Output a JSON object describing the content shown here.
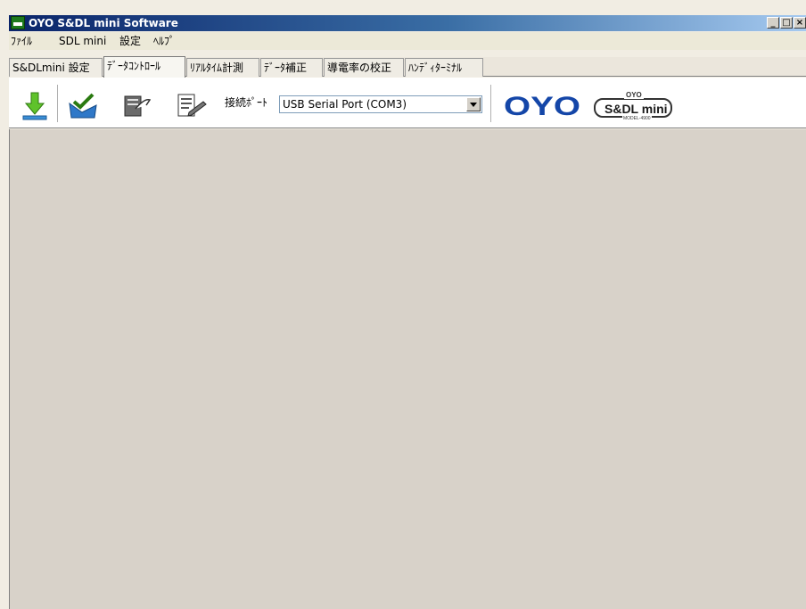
{
  "window": {
    "title": "OYO S&DL mini Software",
    "app_icon": "oyo-app-icon",
    "caption_buttons": {
      "minimize": "_",
      "maximize": "□",
      "close": "×"
    }
  },
  "menu": {
    "items": [
      {
        "label": "ﾌｧｲﾙ"
      },
      {
        "label": "SDL mini"
      },
      {
        "label": "設定"
      },
      {
        "label": "ﾍﾙﾌﾟ"
      }
    ]
  },
  "tabs": [
    {
      "label": "S&DLmini 設定",
      "active": false
    },
    {
      "label": "ﾃﾞｰﾀｺﾝﾄﾛｰﾙ",
      "active": true
    },
    {
      "label": "ﾘｱﾙﾀｲﾑ計測",
      "active": false
    },
    {
      "label": "ﾃﾞｰﾀ補正",
      "active": false
    },
    {
      "label": "導電率の校正",
      "active": false
    },
    {
      "label": "ﾊﾝﾃﾞｨﾀｰﾐﾅﾙ",
      "active": false
    }
  ],
  "toolbar": {
    "tools": [
      {
        "icon": "download-arrow-icon"
      },
      {
        "icon": "check-folder-icon"
      },
      {
        "icon": "document-transfer-icon"
      },
      {
        "icon": "edit-document-icon"
      }
    ],
    "port_label": "接続ﾎﾟｰﾄ",
    "port_value": "USB Serial Port (COM3)",
    "logo_main": "OYO",
    "logo_product": "S&DL mini",
    "logo_product_top": "OYO",
    "logo_product_model": "MODEL-4900"
  },
  "colors": {
    "title_bar_start": "#0a246a",
    "title_bar_end": "#a6caf0",
    "content_bg": "#d8d2c9",
    "logo_blue": "#1446a8"
  }
}
